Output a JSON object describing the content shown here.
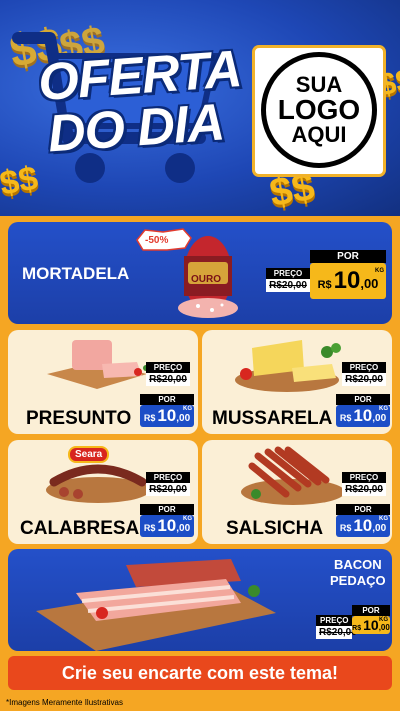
{
  "hero": {
    "title_line1": "OFERTA",
    "title_line2": "DO DIA",
    "logo_line1": "SUA",
    "logo_line2": "LOGO",
    "logo_line3": "AQUI",
    "dollar_sign": "$$"
  },
  "featured": {
    "name": "MORTADELA",
    "discount": "-50%",
    "brand": "OURO",
    "price_label": "PREÇO",
    "old_price": "R$20,00",
    "por_label": "POR",
    "currency": "R$",
    "price_int": "10",
    "price_cents": ",00",
    "unit": "KG"
  },
  "products": [
    {
      "name": "PRESUNTO",
      "price_label": "PREÇO",
      "old_price": "R$20,00",
      "por_label": "POR",
      "currency": "R$",
      "price_int": "10",
      "price_cents": ",00",
      "unit": "KG"
    },
    {
      "name": "MUSSARELA",
      "price_label": "PREÇO",
      "old_price": "R$20,00",
      "por_label": "POR",
      "currency": "R$",
      "price_int": "10",
      "price_cents": ",00",
      "unit": "KG"
    },
    {
      "name": "CALABRESA",
      "brand": "Seara",
      "price_label": "PREÇO",
      "old_price": "R$20,00",
      "por_label": "POR",
      "currency": "R$",
      "price_int": "10",
      "price_cents": ",00",
      "unit": "KG"
    },
    {
      "name": "SALSICHA",
      "price_label": "PREÇO",
      "old_price": "R$20,00",
      "por_label": "POR",
      "currency": "R$",
      "price_int": "10",
      "price_cents": ",00",
      "unit": "KG"
    }
  ],
  "bacon": {
    "name_line1": "BACON",
    "name_line2": "PEDAÇO",
    "price_label": "PREÇO",
    "old_price": "R$20,00",
    "por_label": "POR",
    "currency": "R$",
    "price_int": "10",
    "price_cents": ",00",
    "unit": "KG"
  },
  "footer": {
    "cta": "Crie seu encarte com este tema!",
    "disclaimer": "*Imagens Meramente Ilustrativas"
  },
  "colors": {
    "page_bg": "#f5a623",
    "hero_blue": "#1e47b5",
    "card_blue": "#2450c9",
    "card_cream": "#fbefd6",
    "price_blue": "#1c4ec7",
    "cta_red": "#e9481c",
    "gold": "#f6b81a"
  }
}
